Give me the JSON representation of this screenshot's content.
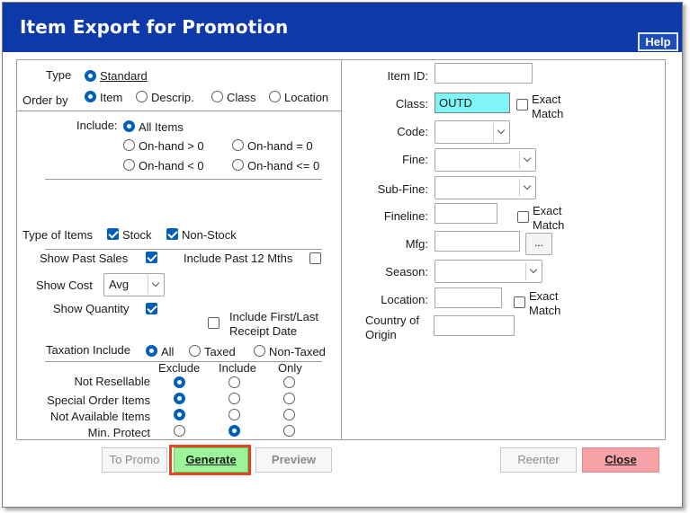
{
  "window": {
    "title": "Item Export for Promotion",
    "help_label": "Help"
  },
  "left": {
    "type_label": "Type",
    "type_standard": "Standard",
    "order_by_label": "Order by",
    "order_item": "Item",
    "order_descrip": "Descrip.",
    "order_class": "Class",
    "order_location": "Location",
    "include_label": "Include:",
    "include_all": "All Items",
    "include_onhand_gt0": "On-hand > 0",
    "include_onhand_eq0": "On-hand = 0",
    "include_onhand_lt0": "On-hand < 0",
    "include_onhand_le0": "On-hand <= 0",
    "type_of_items_label": "Type of Items",
    "stock": "Stock",
    "non_stock": "Non-Stock",
    "show_past_sales": "Show Past Sales",
    "include_past_12": "Include Past 12 Mths",
    "show_cost": "Show Cost",
    "show_cost_value": "Avg",
    "show_quantity": "Show Quantity",
    "include_first_last": "Include First/Last",
    "receipt_date": "Receipt Date",
    "taxation_include": "Taxation Include",
    "tax_all": "All",
    "tax_taxed": "Taxed",
    "tax_non_taxed": "Non-Taxed",
    "col_exclude": "Exclude",
    "col_include": "Include",
    "col_only": "Only",
    "rows": [
      "Not Resellable",
      "Special  Order Items",
      "Not  Available Items",
      "Min. Protect"
    ]
  },
  "right": {
    "item_id": "Item ID:",
    "class": "Class:",
    "class_value": "OUTD",
    "exact": "Exact",
    "match": "Match",
    "code": "Code:",
    "fine": "Fine:",
    "sub_fine": "Sub-Fine:",
    "fineline": "Fineline:",
    "mfg": "Mfg:",
    "mfg_button": "...",
    "season": "Season:",
    "location": "Location:",
    "country_of": "Country of",
    "origin": "Origin"
  },
  "buttons": {
    "to_promo": "To Promo",
    "generate": "Generate",
    "preview": "Preview",
    "reenter": "Reenter",
    "close": "Close"
  }
}
